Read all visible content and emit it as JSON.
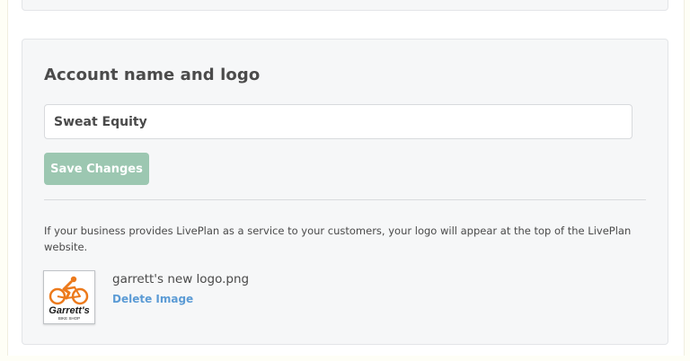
{
  "account": {
    "title": "Account name and logo",
    "name_value": "Sweat Equity",
    "save_label": "Save Changes",
    "info_text": "If your business provides LivePlan as a service to your customers, your logo will appear at the top of the LivePlan website.",
    "logo": {
      "file_name": "garrett's new logo.png",
      "delete_label": "Delete Image",
      "brand_text": "Garrett's",
      "brand_subtext": "BIKE SHOP",
      "icon": "bicycle-rider-icon"
    }
  },
  "colors": {
    "save_button": "#9cc7b1",
    "link": "#5b9bd5",
    "logo_orange": "#ec7a1c"
  }
}
